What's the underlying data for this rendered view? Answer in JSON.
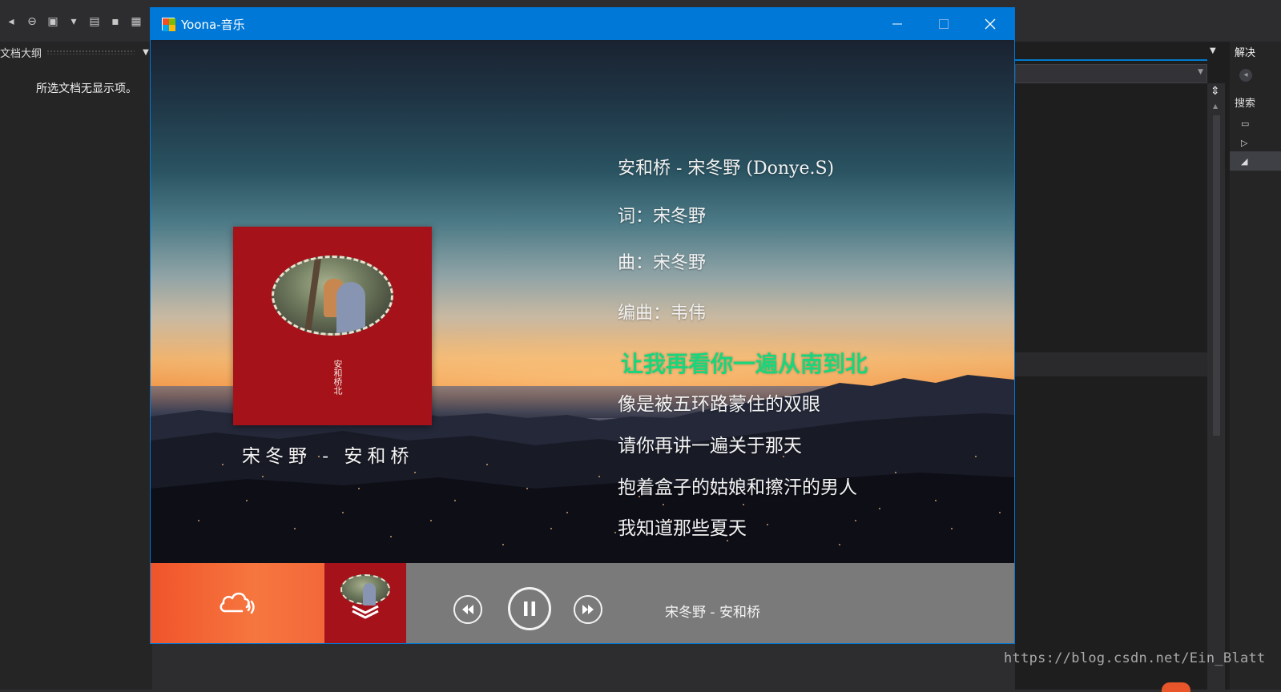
{
  "ide": {
    "outline": {
      "title": "文档大纲",
      "empty_message": "所选文档无显示项。"
    },
    "solution": {
      "title": "解决",
      "search_label": "搜索"
    },
    "watermark": "https://blog.csdn.net/Ein_Blatt"
  },
  "window": {
    "title": "Yoona-音乐"
  },
  "album": {
    "cover_title": "安和桥北",
    "caption": "宋冬野 - 安和桥"
  },
  "lyrics": {
    "lines": [
      "安和桥 - 宋冬野 (Donye.S)",
      "词：宋冬野",
      "曲：宋冬野",
      "编曲：韦伟",
      "让我再看你一遍从南到北",
      "像是被五环路蒙住的双眼",
      "请你再讲一遍关于那天",
      "抱着盒子的姑娘和擦汗的男人",
      "我知道那些夏天"
    ],
    "active_color": "#19d67c"
  },
  "player": {
    "now_playing": "宋冬野 - 安和桥",
    "state": "playing",
    "brand_color": "#f0542a"
  },
  "icons": {
    "app": "app-window-icon",
    "brand": "cloud-sound-icon",
    "prev": "rewind-icon",
    "pause": "pause-icon",
    "next": "fast-forward-icon",
    "minimize": "minimize-icon",
    "maximize": "maximize-icon",
    "close": "close-icon"
  }
}
